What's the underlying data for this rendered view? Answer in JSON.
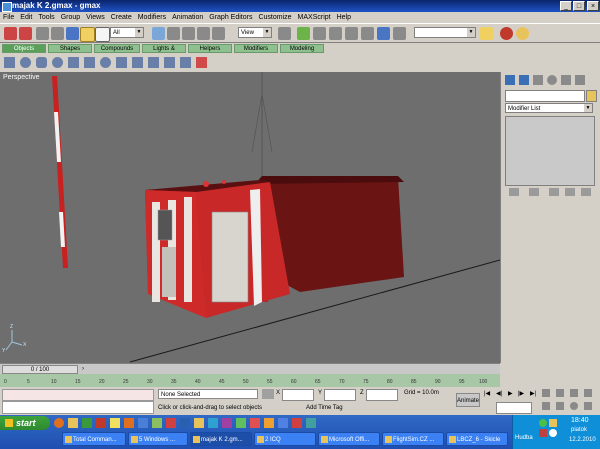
{
  "window": {
    "title": "majak K 2.gmax - gmax"
  },
  "menu": [
    "File",
    "Edit",
    "Tools",
    "Group",
    "Views",
    "Create",
    "Modifiers",
    "Animation",
    "Graph Editors",
    "Customize",
    "MAXScript",
    "Help"
  ],
  "toolbar": {
    "selection_filter": "All",
    "reference_coord": "View",
    "named_selection": ""
  },
  "tabs": [
    "Objects",
    "Shapes",
    "Compounds",
    "Lights & Cameras",
    "Helpers",
    "Modifiers",
    "Modeling"
  ],
  "viewport": {
    "label": "Perspective",
    "axis_x": "X",
    "axis_y": "Y",
    "axis_z": "Z"
  },
  "command_panel": {
    "modifier_list": "Modifier List"
  },
  "timeline": {
    "frame_display": "0 / 100",
    "ticks": [
      "0",
      "5",
      "10",
      "15",
      "20",
      "25",
      "30",
      "35",
      "40",
      "45",
      "50",
      "55",
      "60",
      "65",
      "70",
      "75",
      "80",
      "85",
      "90",
      "95",
      "100"
    ]
  },
  "status": {
    "selection": "None Selected",
    "prompt": "Click or click-and-drag to select objects",
    "x_label": "X",
    "y_label": "Y",
    "z_label": "Z",
    "grid": "Grid = 10.0m",
    "add_time_tag": "Add Time Tag",
    "animate": "Animate"
  },
  "taskbar": {
    "start": "start",
    "tasks": [
      "Total Comman...",
      "5 Windows ...",
      "majak K 2.gm...",
      "2 ICQ",
      "Microsoft Offi...",
      "FlightSim.CZ ...",
      "LBCZ_6 - Skicle"
    ],
    "tray_label": "Hudba",
    "time": "18:40",
    "day": "piatok",
    "date": "12.2.2010"
  },
  "colors": {
    "viewport_bg": "#6e6e6e",
    "title_blue": "#0a246a",
    "taskbar_blue": "#245edb",
    "accent_red": "#c0392b"
  }
}
